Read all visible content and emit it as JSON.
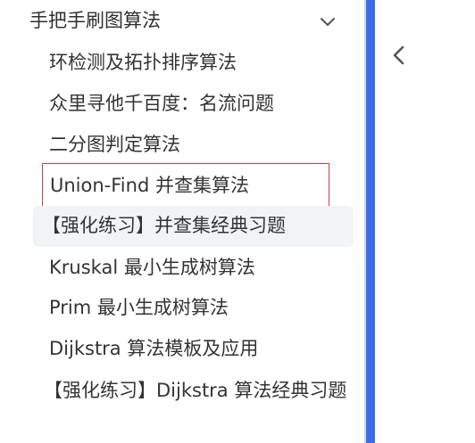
{
  "sidebar": {
    "section_title": "手把手刷图算法",
    "items": [
      {
        "label": "环检测及拓扑排序算法"
      },
      {
        "label": "众里寻他千百度：名流问题"
      },
      {
        "label": "二分图判定算法"
      },
      {
        "label": "Union-Find 并查集算法"
      },
      {
        "label": "【强化练习】并查集经典习题"
      },
      {
        "label": "Kruskal 最小生成树算法"
      },
      {
        "label": "Prim 最小生成树算法"
      },
      {
        "label": "Dijkstra 算法模板及应用"
      },
      {
        "label": "【强化练习】Dijkstra 算法经典习题"
      }
    ]
  },
  "colors": {
    "accent_bar": "#3d6ee8",
    "focus_outline": "#d43a3a",
    "hover_background": "#f2f3f5"
  },
  "icons": {
    "section_toggle": "chevron-down-icon",
    "collapse_sidebar": "chevron-left-icon"
  }
}
